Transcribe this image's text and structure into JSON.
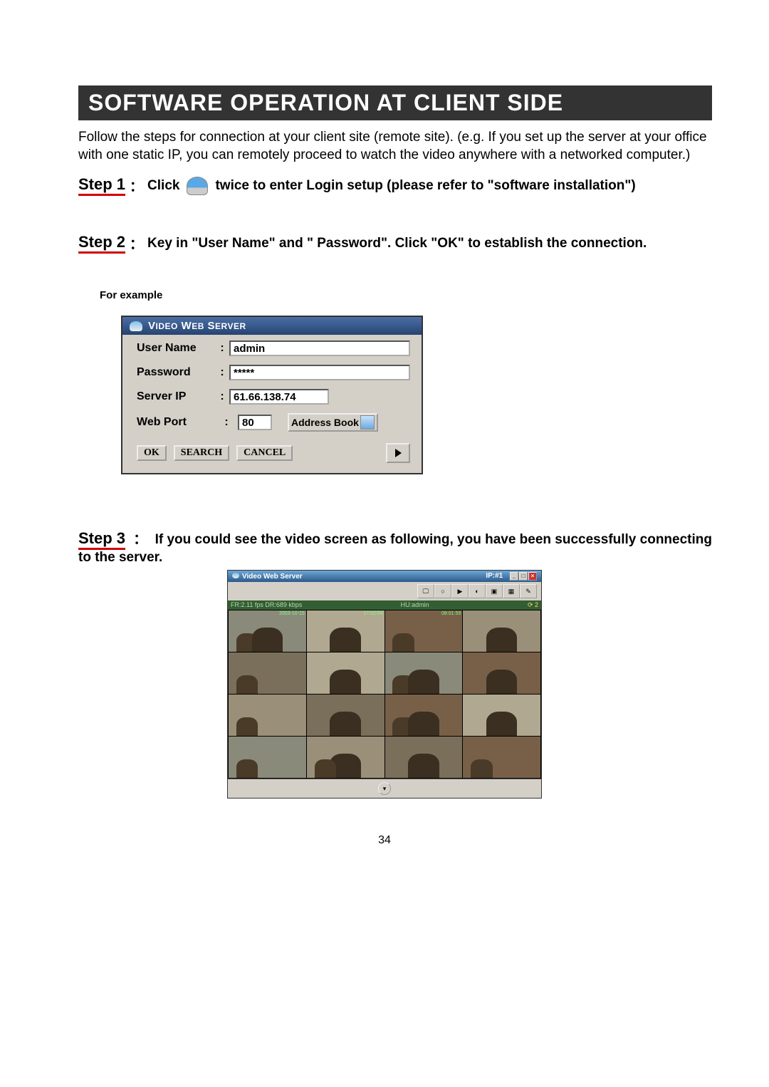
{
  "header": {
    "title": "SOFTWARE OPERATION AT CLIENT SIDE"
  },
  "intro": "Follow  the steps for connection at your client site (remote site).  (e.g.  If you set up the server at your office with one static IP, you can remotely proceed to watch the video anywhere with a networked computer.)",
  "steps": {
    "s1": {
      "label": "Step 1",
      "before": "Click",
      "after": "twice to enter Login setup (please refer to \"software installation\")"
    },
    "s2": {
      "label": "Step 2",
      "text": "Key in \"User Name\" and \" Password\". Click \"OK\" to establish the connection."
    },
    "s3": {
      "label": "Step 3",
      "text": "If you could see the video screen as following, you have been successfully connecting to the server."
    }
  },
  "for_example": "For example",
  "login": {
    "title": "Video Web Server",
    "user_label": "User Name",
    "user_value": "admin",
    "pw_label": "Password",
    "pw_value": "*****",
    "ip_label": "Server IP",
    "ip_value": "61.66.138.74",
    "port_label": "Web Port",
    "port_value": "80",
    "address_book": "Address Book",
    "ok": "OK",
    "search": "SEARCH",
    "cancel": "CANCEL"
  },
  "viewer": {
    "title": "Video Web Server",
    "ip": "IP:#1",
    "status_left": "FR:2.11 fps DR:689 kbps",
    "status_mid": "HU:admin",
    "ts1": "2003-10-15",
    "ts2": "17:02:04",
    "ts3": "08:01:59"
  },
  "page_number": "34"
}
